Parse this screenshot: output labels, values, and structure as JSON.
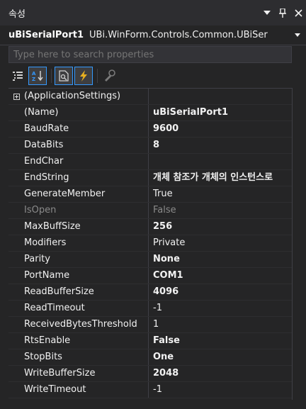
{
  "panel": {
    "title": "속성",
    "dropdown_icon": "chevron-down-icon",
    "pin_icon": "pin-icon",
    "close_icon": "close-icon"
  },
  "object": {
    "name": "uBiSerialPort1",
    "type": "UBi.WinForm.Controls.Common.UBiSer"
  },
  "search": {
    "placeholder": "Type here to search properties"
  },
  "toolbar": {
    "items": [
      "categorized-icon",
      "alphabetical-icon",
      "properties-icon",
      "events-icon",
      "property-pages-icon"
    ]
  },
  "properties": [
    {
      "name": "(ApplicationSettings)",
      "value": "",
      "bold": false,
      "expandable": true,
      "disabled": false
    },
    {
      "name": "(Name)",
      "value": "uBiSerialPort1",
      "bold": true,
      "expandable": false,
      "disabled": false
    },
    {
      "name": "BaudRate",
      "value": "9600",
      "bold": true,
      "expandable": false,
      "disabled": false
    },
    {
      "name": "DataBits",
      "value": "8",
      "bold": true,
      "expandable": false,
      "disabled": false
    },
    {
      "name": "EndChar",
      "value": "",
      "bold": false,
      "expandable": false,
      "disabled": false
    },
    {
      "name": "EndString",
      "value": "개체 참조가 개체의 인스턴스로",
      "bold": true,
      "expandable": false,
      "disabled": false
    },
    {
      "name": "GenerateMember",
      "value": "True",
      "bold": false,
      "expandable": false,
      "disabled": false
    },
    {
      "name": "IsOpen",
      "value": "False",
      "bold": false,
      "expandable": false,
      "disabled": true
    },
    {
      "name": "MaxBuffSize",
      "value": "256",
      "bold": true,
      "expandable": false,
      "disabled": false
    },
    {
      "name": "Modifiers",
      "value": "Private",
      "bold": false,
      "expandable": false,
      "disabled": false
    },
    {
      "name": "Parity",
      "value": "None",
      "bold": true,
      "expandable": false,
      "disabled": false
    },
    {
      "name": "PortName",
      "value": "COM1",
      "bold": true,
      "expandable": false,
      "disabled": false
    },
    {
      "name": "ReadBufferSize",
      "value": "4096",
      "bold": true,
      "expandable": false,
      "disabled": false
    },
    {
      "name": "ReadTimeout",
      "value": "-1",
      "bold": false,
      "expandable": false,
      "disabled": false
    },
    {
      "name": "ReceivedBytesThreshold",
      "value": "1",
      "bold": false,
      "expandable": false,
      "disabled": false
    },
    {
      "name": "RtsEnable",
      "value": "False",
      "bold": true,
      "expandable": false,
      "disabled": false
    },
    {
      "name": "StopBits",
      "value": "One",
      "bold": true,
      "expandable": false,
      "disabled": false
    },
    {
      "name": "WriteBufferSize",
      "value": "2048",
      "bold": true,
      "expandable": false,
      "disabled": false
    },
    {
      "name": "WriteTimeout",
      "value": "-1",
      "bold": false,
      "expandable": false,
      "disabled": false
    }
  ]
}
